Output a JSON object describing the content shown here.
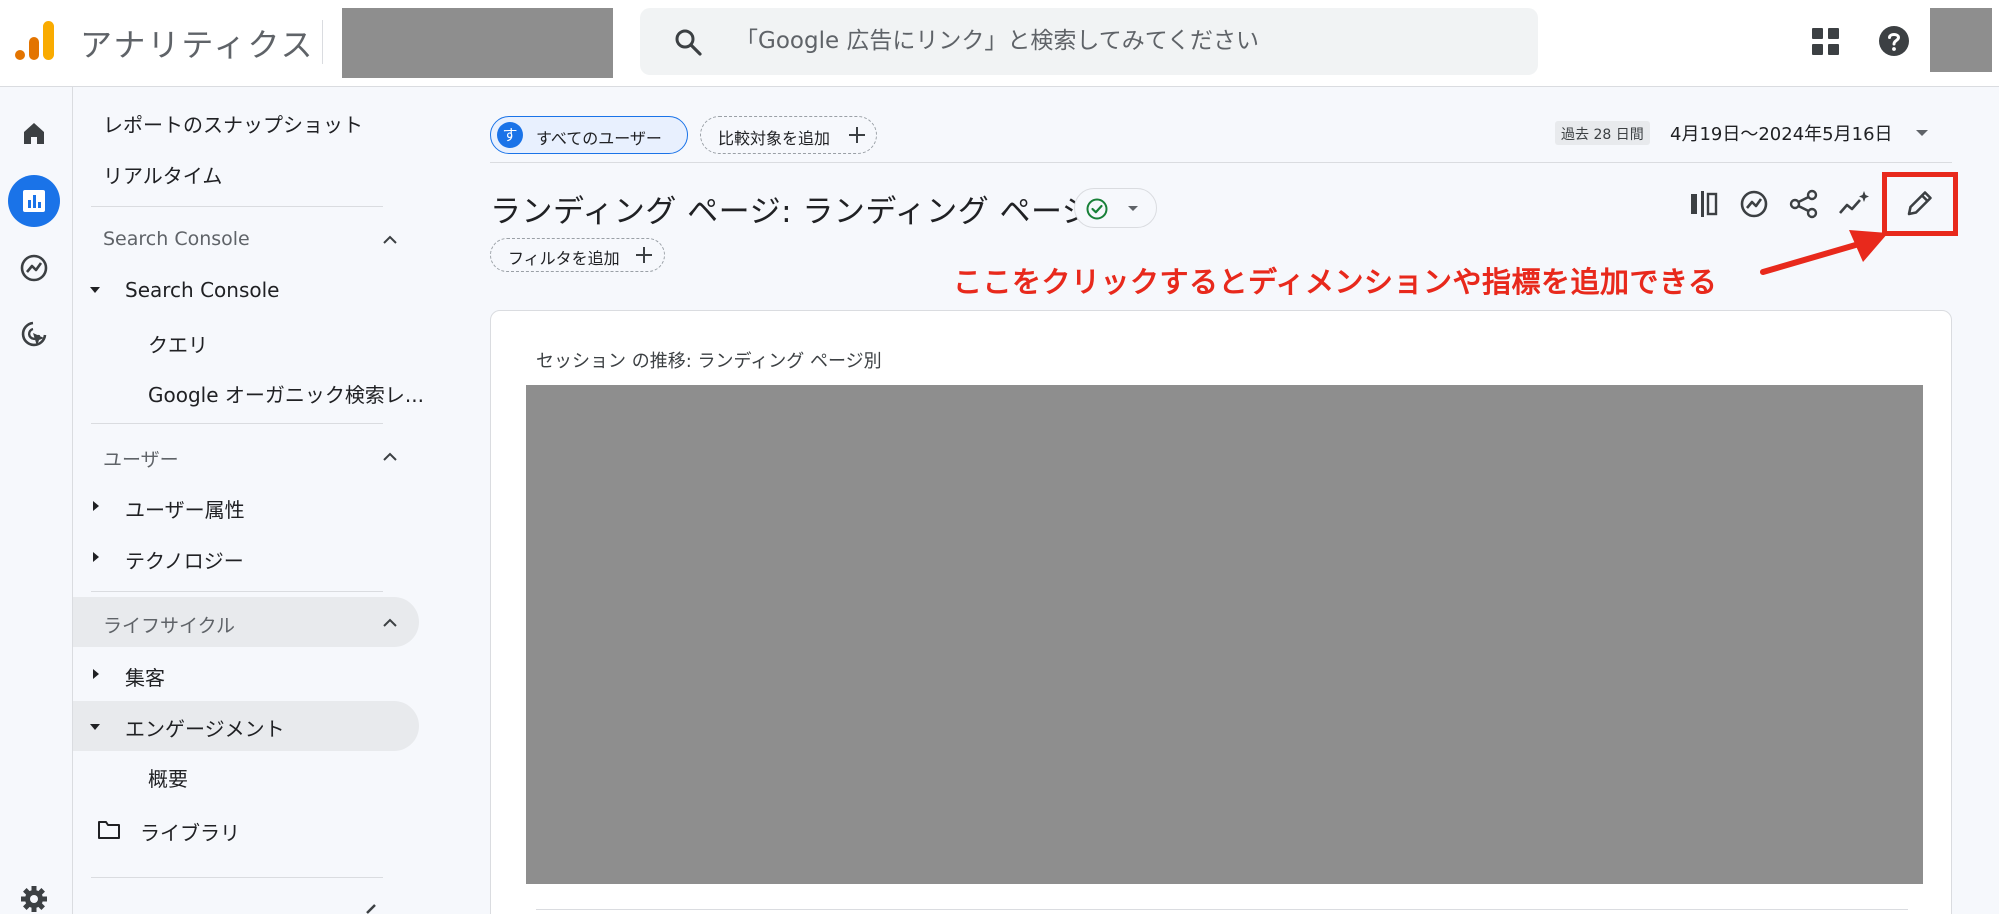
{
  "header": {
    "app_title": "アナリティクス",
    "search_placeholder": "「Google 広告にリンク」と検索してみてください"
  },
  "rail": {
    "items": [
      {
        "icon": "home-icon"
      },
      {
        "icon": "reports-icon",
        "active": true
      },
      {
        "icon": "explore-icon"
      },
      {
        "icon": "advertising-icon"
      },
      {
        "icon": "gear-icon"
      }
    ]
  },
  "nav": {
    "snapshot": "レポートのスナップショット",
    "realtime": "リアルタイム",
    "search_console_section": "Search Console",
    "search_console_item": "Search Console",
    "query": "クエリ",
    "organic": "Google オーガニック検索レ...",
    "user_section": "ユーザー",
    "user_attributes": "ユーザー属性",
    "technology": "テクノロジー",
    "lifecycle_section": "ライフサイクル",
    "acquisition": "集客",
    "engagement": "エンゲージメント",
    "overview": "概要",
    "library": "ライブラリ"
  },
  "main": {
    "segment_badge": "す",
    "segment_label": "すべてのユーザー",
    "compare_label": "比較対象を追加",
    "date_badge": "過去 28 日間",
    "date_range": "4月19日～2024年5月16日",
    "page_title": "ランディング ページ: ランディング ページ",
    "filter_label": "フィルタを追加",
    "annotation": "ここをクリックするとディメンションや指標を追加できる",
    "card_title": "セッション の推移: ランディング ページ別"
  },
  "colors": {
    "accent": "#1a73e8",
    "annotation": "#e8291c",
    "status_ok": "#188038"
  }
}
